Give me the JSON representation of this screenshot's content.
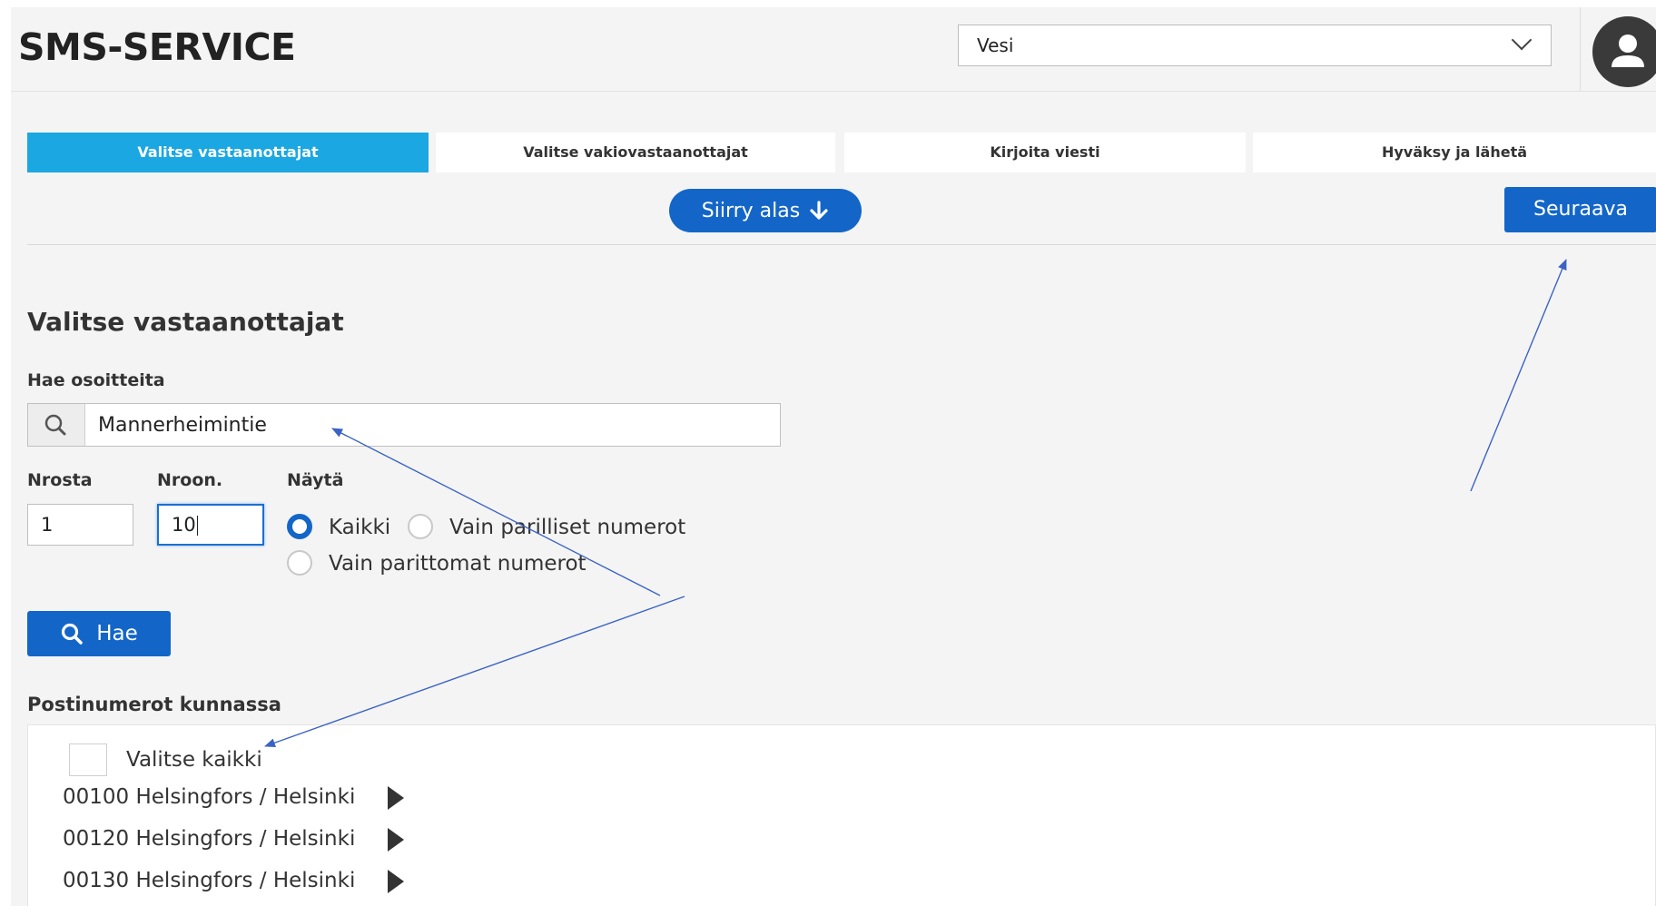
{
  "header": {
    "app_title": "SMS-SERVICE",
    "org_select_value": "Vesi",
    "avatar_icon": "user-icon",
    "chevron_icon": "chevron-down-icon"
  },
  "steps": [
    {
      "label": "Valitse vastaanottajat",
      "active": true
    },
    {
      "label": "Valitse vakiovastaanottajat",
      "active": false
    },
    {
      "label": "Kirjoita viesti",
      "active": false
    },
    {
      "label": "Hyväksy ja lähetä",
      "active": false
    }
  ],
  "actions": {
    "scroll_down_label": "Siirry alas",
    "scroll_down_icon": "arrow-down-icon",
    "next_label": "Seuraava"
  },
  "form": {
    "section_title": "Valitse vastaanottajat",
    "search_label": "Hae osoitteita",
    "search_icon": "search-icon",
    "search_value": "Mannerheimintie",
    "from_label": "Nrosta",
    "from_value": "1",
    "to_label": "Nroon.",
    "to_value": "10",
    "show_label": "Näytä",
    "radio_options": [
      "Kaikki",
      "Vain parilliset numerot",
      "Vain parittomat numerot"
    ],
    "selected_option": "Kaikki",
    "search_button_label": "Hae"
  },
  "postal": {
    "section_title": "Postinumerot kunnassa",
    "select_all_label": "Valitse kaikki",
    "items": [
      "00100 Helsingfors / Helsinki",
      "00120 Helsingfors / Helsinki",
      "00130 Helsingfors / Helsinki"
    ],
    "expand_icon": "caret-right-icon"
  },
  "colors": {
    "accent_blue": "#1366c8",
    "active_step": "#1ba7e1",
    "annotation_arrow": "#3b63c4"
  }
}
